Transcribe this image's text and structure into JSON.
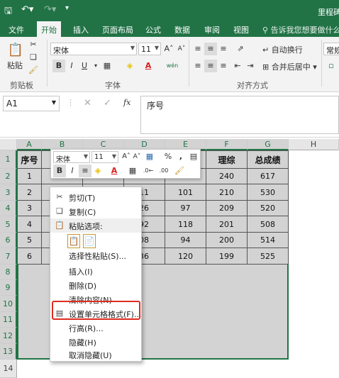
{
  "app": {
    "title_partial": "里程碑",
    "colors": {
      "brand": "#217346",
      "highlight": "#e02b20"
    }
  },
  "ribbon_tabs": [
    "文件",
    "开始",
    "插入",
    "页面布局",
    "公式",
    "数据",
    "审阅",
    "视图"
  ],
  "active_tab": "开始",
  "tell_me": "告诉我您想要做什么...",
  "ribbon": {
    "paste_label": "粘贴",
    "clipboard_label": "剪贴板",
    "font_group_label": "字体",
    "alignment_label": "对齐方式",
    "font_name": "宋体",
    "font_size": "11",
    "bold": "B",
    "italic": "I",
    "underline": "U",
    "wrap_text": "自动换行",
    "merge_center": "合并后居中",
    "number_format": "常规",
    "grow_font": "A˄",
    "shrink_font": "A˅",
    "wen": "wén",
    "font_color_letter": "A"
  },
  "formula_bar": {
    "name_box": "A1",
    "fx": "fx",
    "content": "序号"
  },
  "columns": [
    "A",
    "B",
    "C",
    "D",
    "E",
    "F",
    "G",
    "H"
  ],
  "rows": [
    "1",
    "2",
    "3",
    "4",
    "5",
    "6",
    "7",
    "8",
    "9",
    "10",
    "11",
    "12",
    "13",
    "14"
  ],
  "table": {
    "header_visible": [
      "序号",
      "理综",
      "总成绩"
    ],
    "rows": [
      {
        "a": "1",
        "f": "240",
        "g": "617"
      },
      {
        "a": "2",
        "d": "11",
        "e": "101",
        "f": "210",
        "g": "530"
      },
      {
        "a": "3",
        "d": "26",
        "e": "97",
        "f": "209",
        "g": "520"
      },
      {
        "a": "4",
        "d": "92",
        "e": "118",
        "f": "201",
        "g": "508"
      },
      {
        "a": "5",
        "d": "08",
        "e": "94",
        "f": "200",
        "g": "514"
      },
      {
        "a": "6",
        "d": "36",
        "e": "120",
        "f": "199",
        "g": "525"
      }
    ]
  },
  "mini_toolbar": {
    "font_name": "宋体",
    "font_size": "11",
    "bold": "B",
    "italic": "I",
    "percent": "%",
    "comma": ",",
    "color_a": "A"
  },
  "context_menu": {
    "cut": "剪切(T)",
    "copy": "复制(C)",
    "paste_options": "粘贴选项:",
    "paste_special": "选择性粘贴(S)...",
    "insert": "插入(I)",
    "delete": "删除(D)",
    "clear": "清除内容(N)",
    "format_cells": "设置单元格格式(F)...",
    "row_height": "行高(R)...",
    "hide": "隐藏(H)",
    "unhide": "取消隐藏(U)"
  }
}
